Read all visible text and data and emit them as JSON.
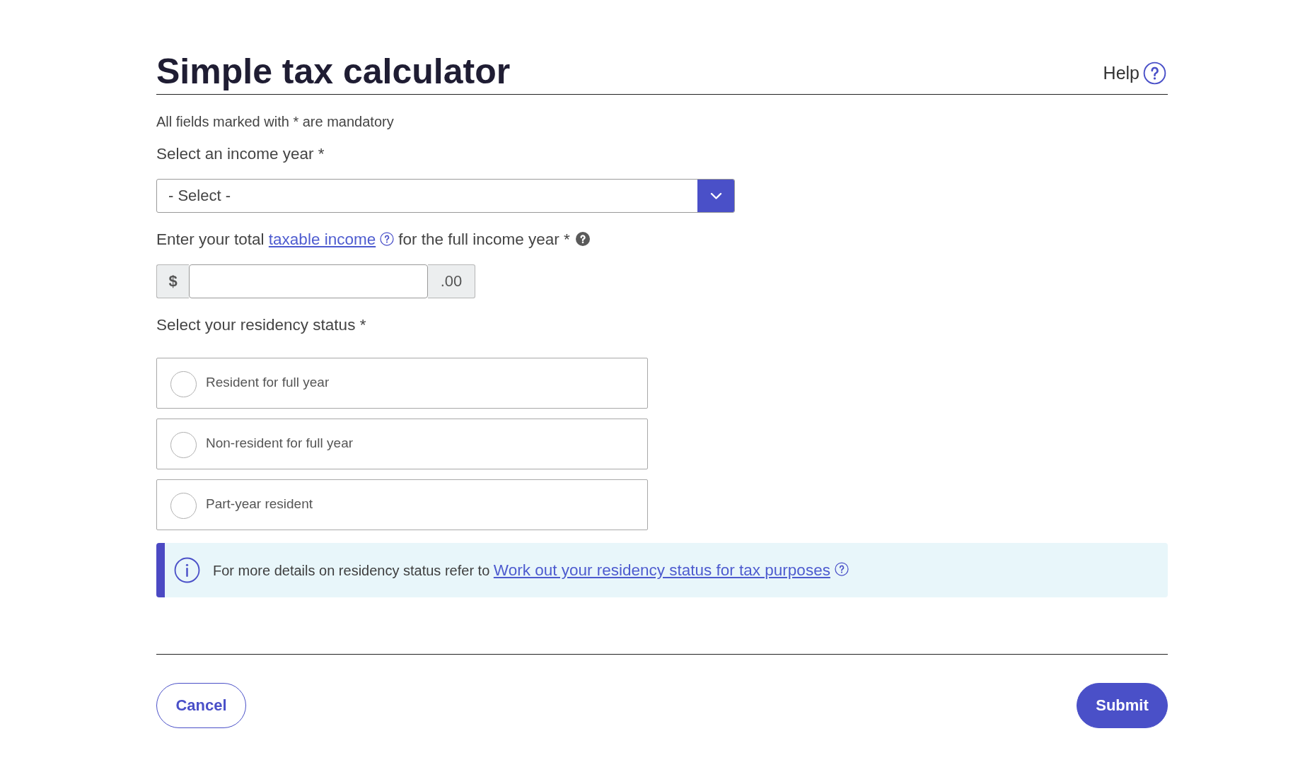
{
  "page": {
    "title": "Simple tax calculator",
    "help_link": "Help"
  },
  "mandatory_note": "All fields marked with * are mandatory",
  "income_year": {
    "label": "Select an income year *",
    "value": "- Select -"
  },
  "taxable_income": {
    "label_before": "Enter your total",
    "link": "taxable income",
    "label_after": "for the full income year *",
    "prefix": "$",
    "suffix": ".00"
  },
  "residency": {
    "label": "Select your residency status *",
    "options": [
      {
        "label": "Resident for full year",
        "selected": false
      },
      {
        "label": "Non-resident for full year",
        "selected": false
      },
      {
        "label": "Part-year resident",
        "selected": false
      }
    ]
  },
  "info": {
    "text": "For more details on residency status refer to",
    "link": "Work out your residency status for tax purposes"
  },
  "actions": [
    {
      "label": "Cancel",
      "kind": "secondary"
    },
    {
      "label": "Submit",
      "kind": "primary"
    }
  ]
}
